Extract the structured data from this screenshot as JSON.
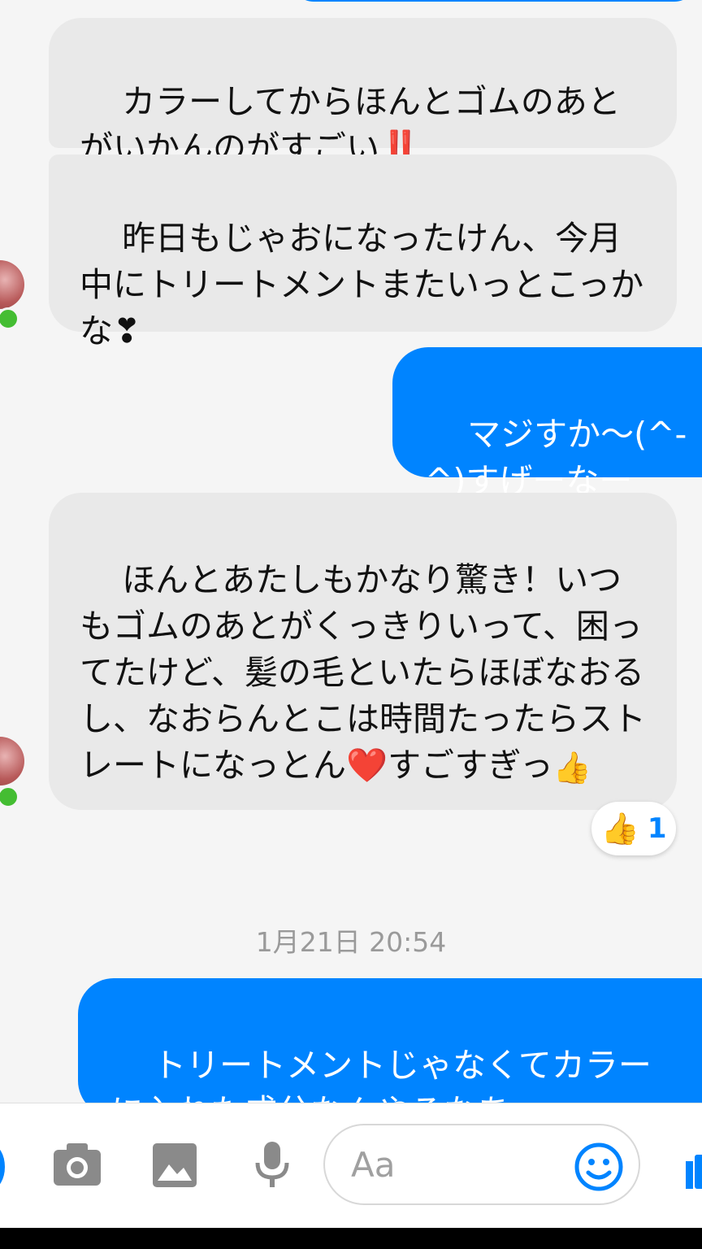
{
  "messages": [
    {
      "id": "m1",
      "sender": "other",
      "text": "カラーしてからほんとゴムのあとがいかんのがすごい",
      "emoji": "‼️"
    },
    {
      "id": "m2",
      "sender": "other",
      "text": "昨日もじゃおになったけん、今月中にトリートメントまたいっとこっかな",
      "emoji": "❣"
    },
    {
      "id": "m3",
      "sender": "me",
      "text": "マジすか〜(^-^)すげーなー"
    },
    {
      "id": "m4",
      "sender": "other",
      "text": "ほんとあたしもかなり驚き！いつもゴムのあとがくっきりいって、困ってたけど、髪の毛といたらほぼなおるし、なおらんとこは時間たったらストレートになっとん",
      "emoji_heart": "❤️",
      "text_after": "すごすぎっ",
      "emoji_end": "👍"
    },
    {
      "id": "m5",
      "sender": "me",
      "text": "トリートメントじゃなくてカラーに入れた成分なんやろなあ"
    }
  ],
  "reaction": {
    "icon": "thumbs-up-icon",
    "glyph": "👍",
    "count": "1"
  },
  "timestamp": "1月21日 20:54",
  "composer": {
    "placeholder": "Aa",
    "icons": [
      "camera-icon",
      "image-icon",
      "microphone-icon",
      "emoji-icon",
      "like-icon"
    ]
  },
  "colors": {
    "outgoing_bubble": "#0084ff",
    "incoming_bubble": "#e9e9e9",
    "online_indicator": "#44bd32",
    "icon_gray": "#8a8a8a",
    "accent": "#0084ff"
  }
}
